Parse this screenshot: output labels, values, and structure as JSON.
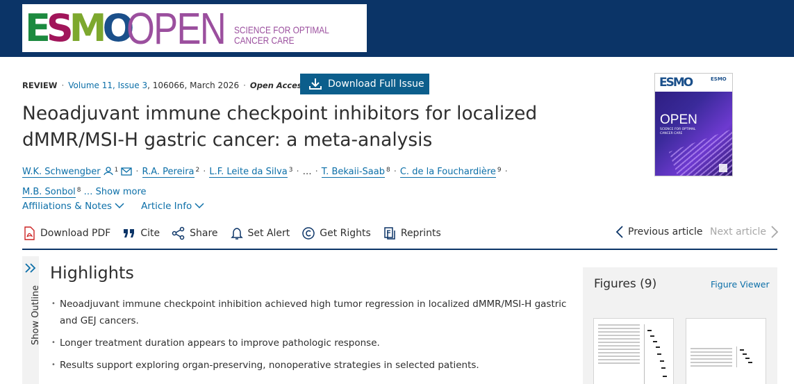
{
  "brand": {
    "esmo_letters": [
      "E",
      "S",
      "M",
      "O"
    ],
    "esmo_colors": [
      "#1c8a3f",
      "#a1155a",
      "#7da82e",
      "#1a4f8a"
    ],
    "open": "OPEN",
    "tagline_line1": "SCIENCE FOR OPTIMAL",
    "tagline_line2": "CANCER CARE"
  },
  "meta": {
    "type": "REVIEW",
    "volume": "Volume 11, Issue 3",
    "article_info": ", 106066, March 2026",
    "access": "Open Access",
    "download_issue_label": "Download Full Issue"
  },
  "article": {
    "title_line1": "Neoadjuvant immune checkpoint inhibitors for localized",
    "title_line2": "dMMR/MSI-H gastric cancer: a meta-analysis"
  },
  "authors": [
    {
      "name": "W.K. Schwengber",
      "sup": "1"
    },
    {
      "name": "R.A. Pereira",
      "sup": "2"
    },
    {
      "name": "L.F. Leite da Silva",
      "sup": "3"
    },
    {
      "name": "T. Bekaii-Saab",
      "sup": "8"
    },
    {
      "name": "C. de la Fouchardière",
      "sup": "9"
    },
    {
      "name": "M.B. Sonbol",
      "sup": "8"
    }
  ],
  "authors_ellipsis": "…",
  "authors_show_more": "… Show more",
  "info_links": {
    "affiliations": "Affiliations & Notes",
    "article_info": "Article Info"
  },
  "toolbar": {
    "download_pdf": "Download PDF",
    "cite": "Cite",
    "share": "Share",
    "set_alert": "Set Alert",
    "get_rights": "Get Rights",
    "reprints": "Reprints",
    "previous": "Previous article",
    "next": "Next article"
  },
  "outline": {
    "label": "Show Outline"
  },
  "highlights": {
    "heading": "Highlights",
    "items": [
      "Neoadjuvant immune checkpoint inhibition achieved high tumor regression in localized dMMR/MSI-H gastric and GEJ cancers.",
      "Longer treatment duration appears to improve pathologic response.",
      "Results support exploring organ-preserving, nonoperative strategies in selected patients."
    ]
  },
  "cover": {
    "esmo": "ESMO",
    "mini": "ESMO",
    "open": "OPEN",
    "sub_line1": "SCIENCE FOR OPTIMAL",
    "sub_line2": "CANCER CARE"
  },
  "figures": {
    "heading": "Figures (9)",
    "viewer": "Figure Viewer"
  },
  "colors": {
    "header_bg": "#0b3467",
    "link": "#0c6fa8",
    "button_bg": "#0c5e8c",
    "brand_purple": "#9b4f9e"
  }
}
